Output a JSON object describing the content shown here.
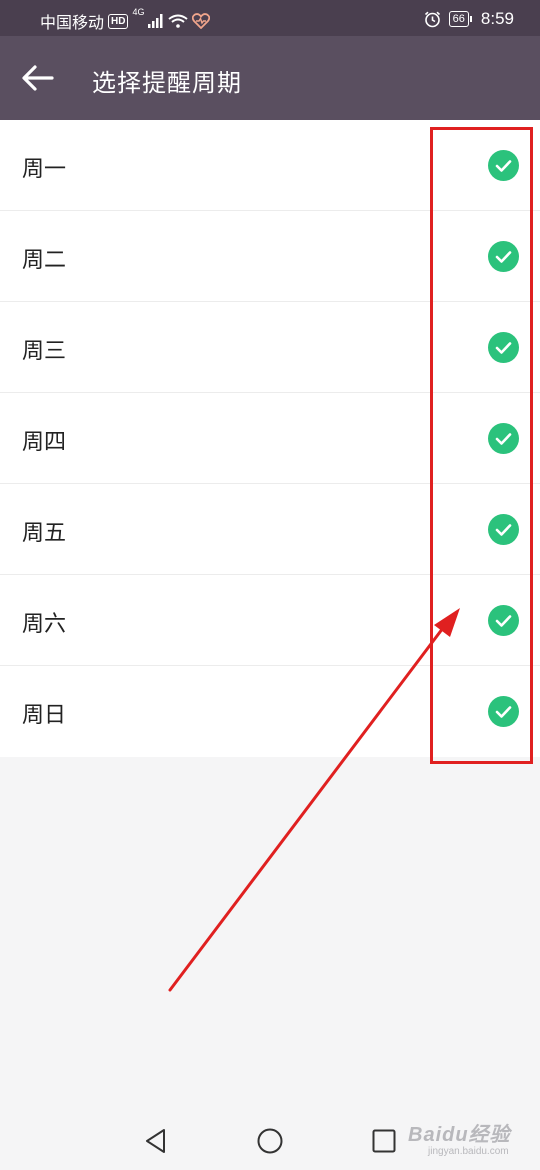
{
  "status_bar": {
    "carrier": "中国移动",
    "hd_badge": "HD",
    "network_type": "4G",
    "battery": "66",
    "time": "8:59"
  },
  "app_bar": {
    "title": "选择提醒周期",
    "back_icon": "back-arrow-icon"
  },
  "days": [
    {
      "label": "周一",
      "checked": true
    },
    {
      "label": "周二",
      "checked": true
    },
    {
      "label": "周三",
      "checked": true
    },
    {
      "label": "周四",
      "checked": true
    },
    {
      "label": "周五",
      "checked": true
    },
    {
      "label": "周六",
      "checked": true
    },
    {
      "label": "周日",
      "checked": true
    }
  ],
  "colors": {
    "status_bar_bg": "#4a3f4f",
    "app_bar_bg": "#5a4f60",
    "check_green": "#2bc27c",
    "annotation_red": "#e02020",
    "page_bg": "#f5f5f6"
  },
  "nav_bar": {
    "back_icon": "triangle-back-icon",
    "home_icon": "circle-home-icon",
    "recents_icon": "square-recents-icon"
  },
  "watermark": {
    "brand": "Baidu经验",
    "url": "jingyan.baidu.com"
  }
}
